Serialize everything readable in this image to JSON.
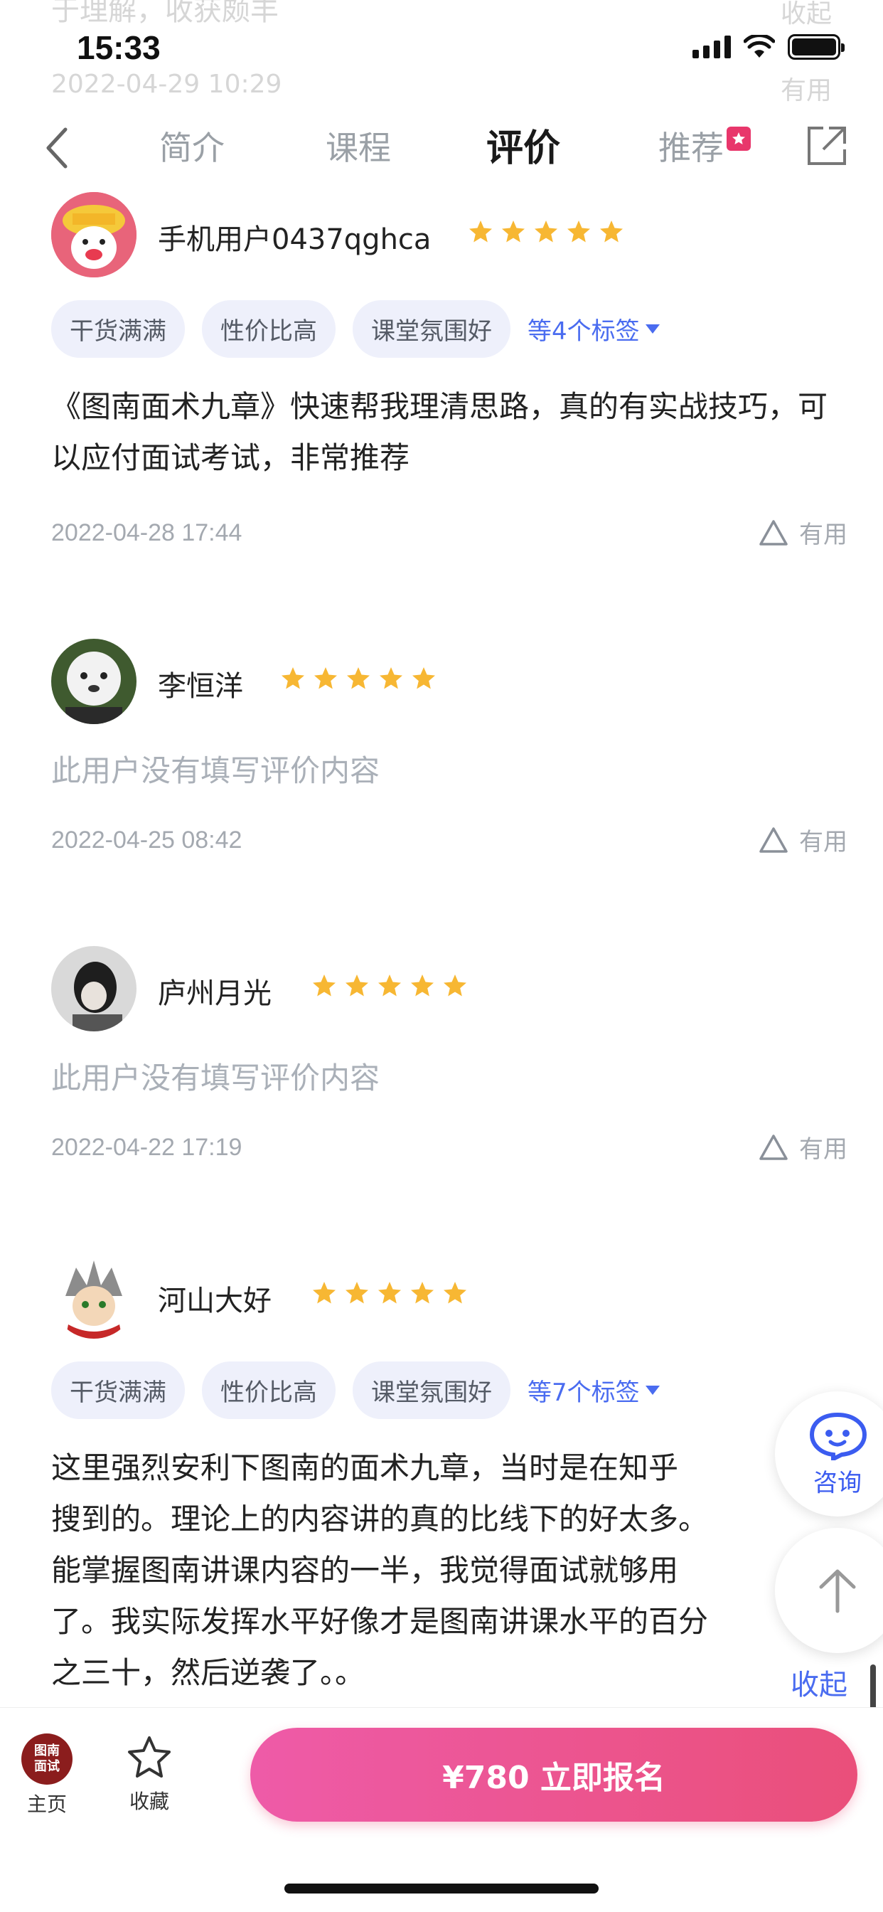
{
  "status_bar": {
    "time": "15:33"
  },
  "ghost": {
    "top_text": "于理解，收获颇丰",
    "date": "2022-04-29 10:29",
    "right_text": "收起",
    "useful": "有用"
  },
  "nav": {
    "tabs": [
      "简介",
      "课程",
      "评价",
      "推荐"
    ],
    "active": "评价"
  },
  "reviews": [
    {
      "username": "手机用户0437qghca",
      "rating": 5,
      "tags": [
        "干货满满",
        "性价比高",
        "课堂氛围好"
      ],
      "more_tags": "等4个标签",
      "text": "《图南面术九章》快速帮我理清思路，真的有实战技巧，可以应付面试考试，非常推荐",
      "date": "2022-04-28 17:44",
      "useful": "有用"
    },
    {
      "username": "李恒洋",
      "rating": 5,
      "text": "此用户没有填写评价内容",
      "date": "2022-04-25 08:42",
      "useful": "有用"
    },
    {
      "username": "庐州月光",
      "rating": 5,
      "text": "此用户没有填写评价内容",
      "date": "2022-04-22 17:19",
      "useful": "有用"
    },
    {
      "username": "河山大好",
      "rating": 5,
      "tags": [
        "干货满满",
        "性价比高",
        "课堂氛围好"
      ],
      "more_tags": "等7个标签",
      "text_lines": [
        "这里强烈安利下图南的面术九章，当时是在知乎",
        "搜到的。理论上的内容讲的真的比线下的好太多。",
        "能掌握图南讲课内容的一半，我觉得面试就够用",
        "了。我实际发挥水平好像才是图南讲课水平的百分",
        "之三十，然后逆袭了。。"
      ],
      "collapse": "收起"
    }
  ],
  "floating": {
    "consult": "咨询"
  },
  "bottom_bar": {
    "home_logo": [
      "图南",
      "面试"
    ],
    "home": "主页",
    "favorite": "收藏",
    "enroll": "¥780  立即报名"
  },
  "colors": {
    "accent": "#4a6cf0",
    "star": "#f7b733",
    "cta_start": "#ee5ba8",
    "cta_end": "#ea4f7a"
  }
}
